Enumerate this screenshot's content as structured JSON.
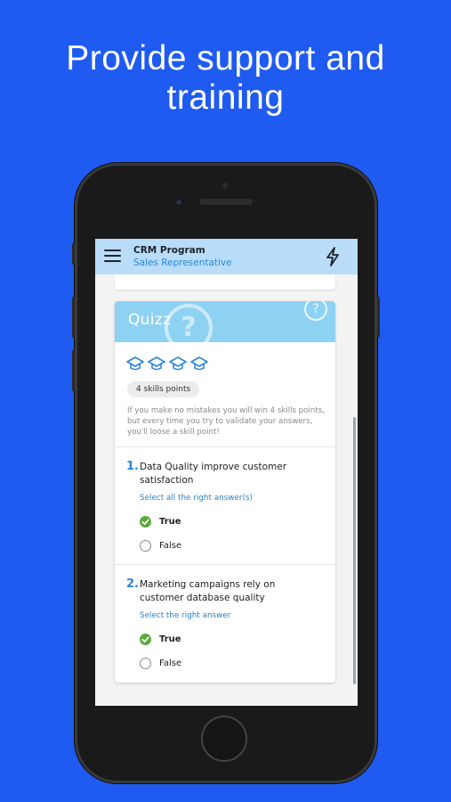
{
  "headline": {
    "line1": "Provide support and",
    "line2": "training"
  },
  "app_bar": {
    "title": "CRM Program",
    "subtitle": "Sales Representative",
    "menu_icon": "hamburger-icon",
    "action_icon": "lightning-bolt-icon"
  },
  "quiz": {
    "title": "Quizz",
    "watermark": "?",
    "help": "?",
    "skill_icon": "graduation-cap-icon",
    "skill_count": 4,
    "points_label": "4 skills points",
    "explanation": "If you make no mistakes you will win 4 skills points, but every time you try to validate your answers, you'll loose a skill point!",
    "questions": [
      {
        "number": "1.",
        "text": "Data Quality improve customer satisfaction",
        "instruction": "Select all the right answer(s)",
        "options": [
          {
            "label": "True",
            "selected": true
          },
          {
            "label": "False",
            "selected": false
          }
        ]
      },
      {
        "number": "2.",
        "text": "Marketing campaigns rely on customer database quality",
        "instruction": "Select the right answer",
        "options": [
          {
            "label": "True",
            "selected": true
          },
          {
            "label": "False",
            "selected": false
          }
        ]
      }
    ]
  },
  "colors": {
    "background": "#1f5bf0",
    "app_bar": "#b9ddf8",
    "quiz_header": "#8ed2f3",
    "accent": "#2a86d8",
    "check": "#5aaa3a"
  }
}
